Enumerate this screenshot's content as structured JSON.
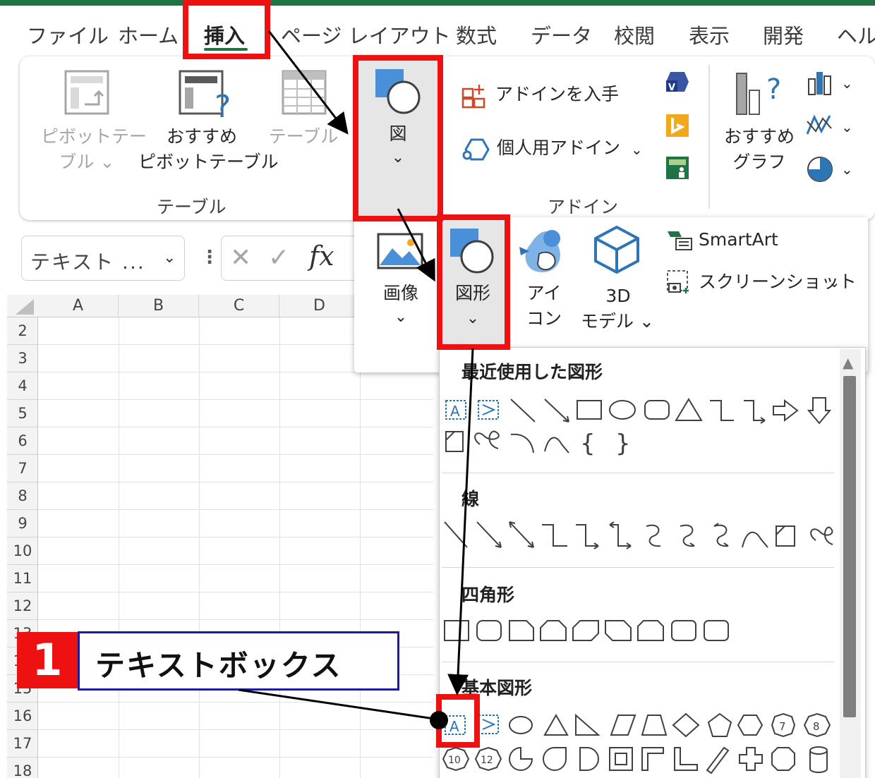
{
  "menu_tabs": [
    "ファイル",
    "ホーム",
    "挿入",
    "ページ レイアウト",
    "数式",
    "データ",
    "校閲",
    "表示",
    "開発",
    "ヘルプ"
  ],
  "active_tab": "挿入",
  "ribbon": {
    "pivot_table": [
      "ピボットテー",
      "ブル ⌄"
    ],
    "recommended_pivot": [
      "おすすめ",
      "ピボットテーブル"
    ],
    "table": "テーブル",
    "illustrations": "図",
    "get_addins": "アドインを入手",
    "my_addins": "個人用アドイン",
    "recommended_charts": [
      "おすすめ",
      "グラフ"
    ],
    "group_table": "テーブル",
    "group_addins": "アドイン"
  },
  "formula_bar": {
    "name_box": "テキスト ...",
    "cancel": "✕",
    "enter": "✓",
    "fx": "fx"
  },
  "columns": [
    "A",
    "B",
    "C",
    "D"
  ],
  "rows": [
    "2",
    "3",
    "4",
    "5",
    "6",
    "7",
    "8",
    "9",
    "10",
    "11",
    "12",
    "13",
    "14",
    "15",
    "16",
    "17",
    "18"
  ],
  "illustrations_menu": {
    "pictures": "画像",
    "shapes": "図形",
    "icons": [
      "アイ",
      "コン"
    ],
    "models": [
      "3D",
      "モデル ⌄"
    ],
    "smartart": "SmartArt",
    "screenshot": "スクリーンショット"
  },
  "shapes_menu": {
    "recent": "最近使用した図形",
    "lines": "線",
    "rectangles": "四角形",
    "basic": "基本図形"
  },
  "callout": {
    "number": "1",
    "text": "テキストボックス"
  },
  "colors": {
    "excel_green": "#217346",
    "highlight_red": "#EE1111",
    "callout_border": "#1C1C9C",
    "shape_blue": "#2E75B6",
    "icon_blue": "#4A90D9"
  }
}
